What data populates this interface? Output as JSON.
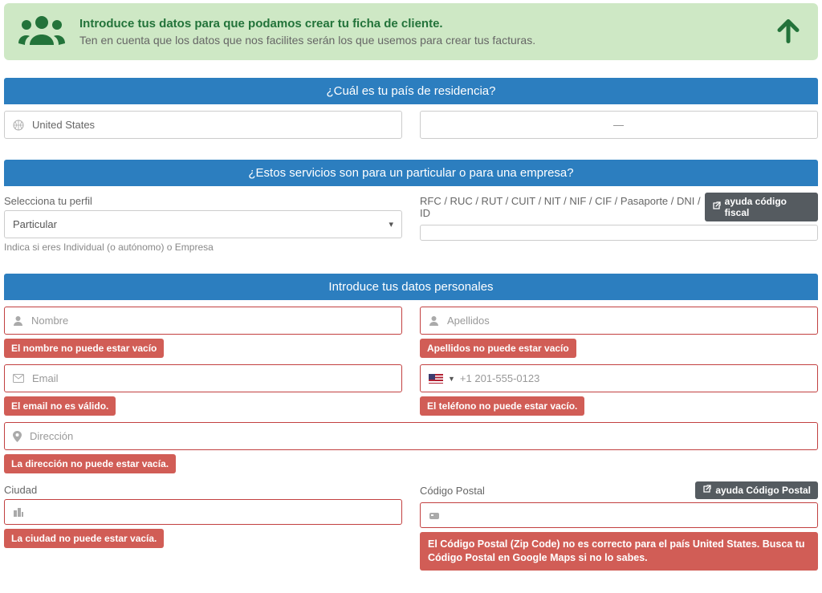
{
  "intro": {
    "title": "Introduce tus datos para que podamos crear tu ficha de cliente.",
    "subtitle": "Ten en cuenta que los datos que nos facilites serán los que usemos para crear tus facturas."
  },
  "sections": {
    "country": "¿Cuál es tu país de residencia?",
    "profile": "¿Estos servicios son para un particular o para una empresa?",
    "personal": "Introduce tus datos personales"
  },
  "country": {
    "selected": "United States",
    "flag_placeholder": "—"
  },
  "profile": {
    "select_label": "Selecciona tu perfil",
    "selected": "Particular",
    "helper": "Indica si eres Individual (o autónomo) o Empresa",
    "tax_label": "RFC / RUC / RUT / CUIT / NIT / NIF / CIF / Pasaporte / DNI / ID",
    "help_tax": "ayuda código fiscal"
  },
  "personal": {
    "name_placeholder": "Nombre",
    "name_error": "El nombre no puede estar vacío",
    "surname_placeholder": "Apellidos",
    "surname_error": "Apellidos no puede estar vacío",
    "email_placeholder": "Email",
    "email_error": "El email no es válido.",
    "phone_placeholder": "+1 201-555-0123",
    "phone_error": "El teléfono no puede estar vacío.",
    "address_placeholder": "Dirección",
    "address_error": "La dirección no puede estar vacía.",
    "city_label": "Ciudad",
    "city_error": "La ciudad no puede estar vacía.",
    "zip_label": "Código Postal",
    "zip_error": "El Código Postal (Zip Code) no es correcto para el país United States. Busca tu Código Postal en Google Maps si no lo sabes.",
    "help_zip": "ayuda Código Postal"
  }
}
